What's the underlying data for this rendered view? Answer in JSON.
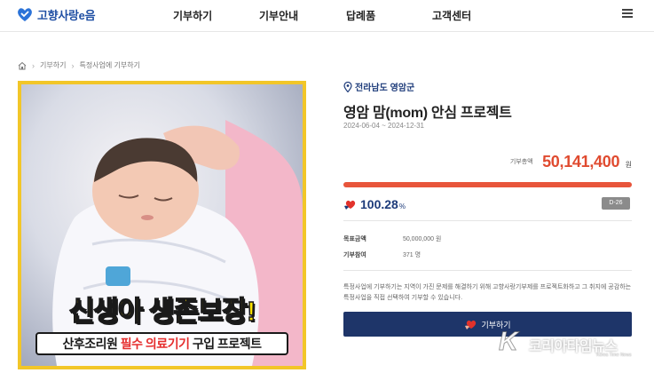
{
  "header": {
    "logo_text": "고향사랑e음",
    "nav": [
      "기부하기",
      "기부안내",
      "답례품",
      "고객센터"
    ]
  },
  "breadcrumb": {
    "items": [
      "기부하기",
      "특정사업에 기부하기"
    ]
  },
  "project": {
    "image_headline": "신생아 생존보장!",
    "image_sub_prefix": "산후조리원 ",
    "image_sub_highlight": "필수 의료기기",
    "image_sub_suffix": " 구입 프로젝트",
    "region": "전라남도 영암군",
    "title": "영암 맘(mom) 안심 프로젝트",
    "period": "2024-06-04 ~ 2024-12-31",
    "amount_label": "기부총액",
    "amount_value": "50,141,400",
    "amount_unit": "원",
    "progress_fraction": 1.0,
    "percent_value": "100.28",
    "percent_unit": "%",
    "dday": "D-26",
    "goal_label": "목표금액",
    "goal_value": "50,000,000 원",
    "participants_label": "기부참여",
    "participants_value": "371 명",
    "description": "특정사업에 기부하기는 지역이 가진 문제를 해결하기 위해 고향사랑기부제를 프로젝트화하고 그 취지에 공감하는 특정사업을 직접 선택하여 기부할 수 있습니다.",
    "donate_label": "기부하기"
  },
  "watermark": {
    "text": "코리아타임뉴스",
    "sub": "Korea Time News"
  },
  "colors": {
    "navy": "#1e3569",
    "accent": "#e04b30",
    "image_frame": "#f2c628"
  }
}
